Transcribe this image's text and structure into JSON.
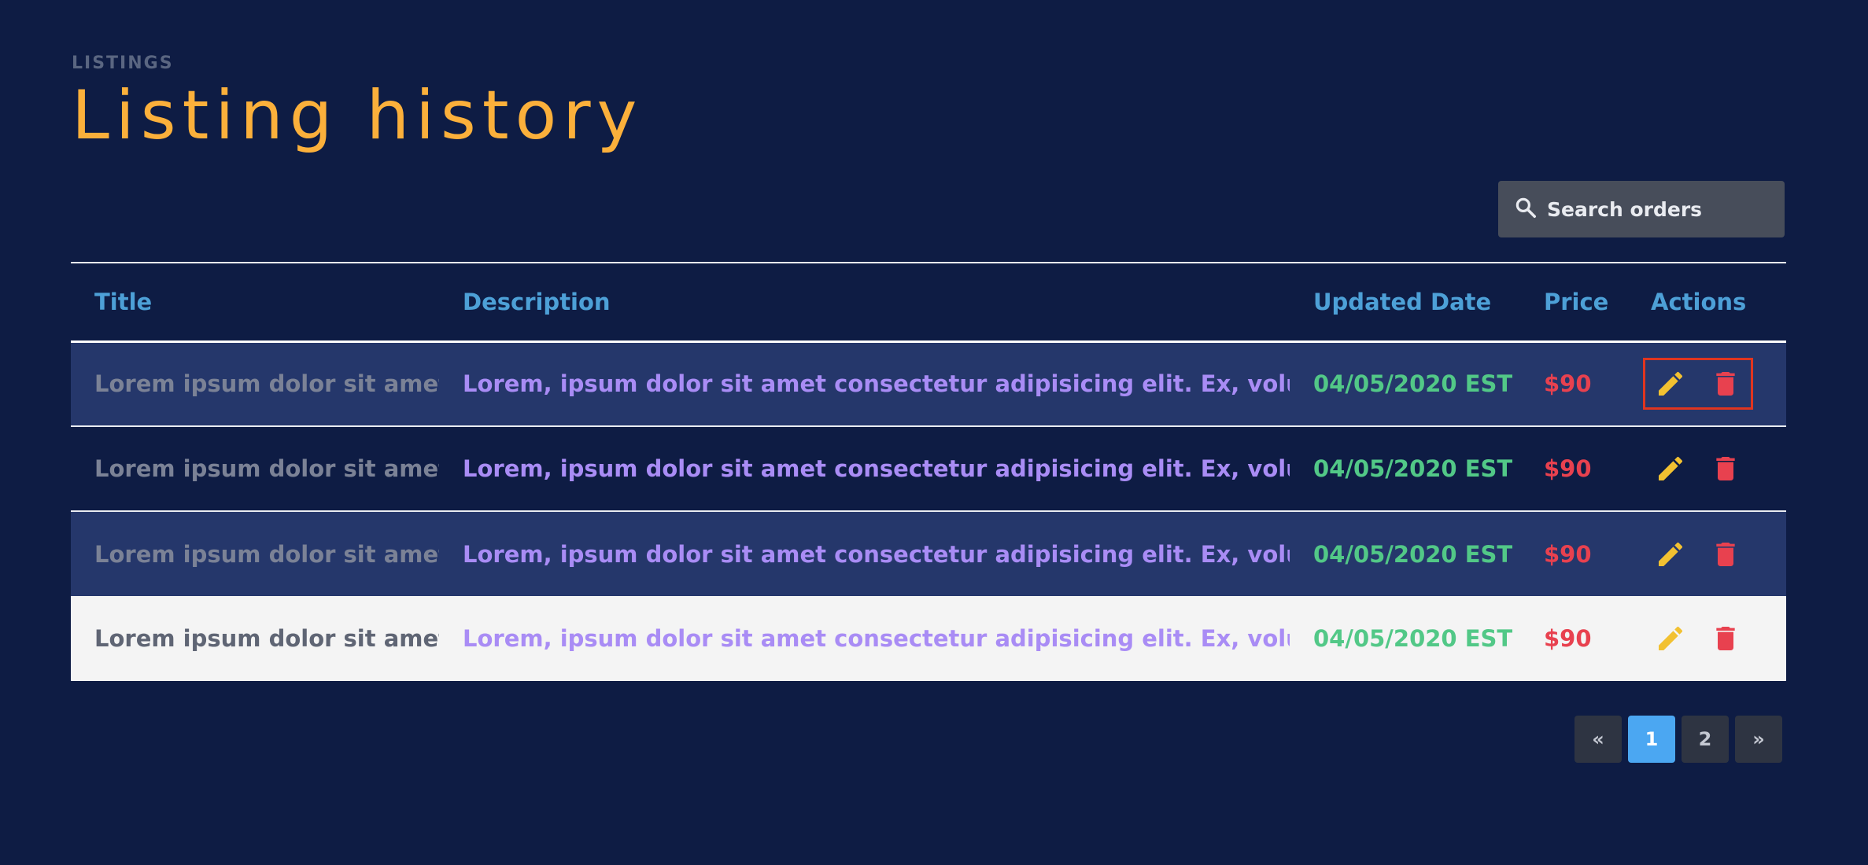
{
  "header": {
    "eyebrow": "LISTINGS",
    "title": "Listing history"
  },
  "search": {
    "placeholder": "Search orders",
    "icon": "search-icon"
  },
  "table": {
    "columns": [
      "Title",
      "Description",
      "Updated Date",
      "Price",
      "Actions"
    ],
    "rows": [
      {
        "title": "Lorem ipsum dolor sit amet.",
        "description": "Lorem, ipsum dolor sit amet consectetur adipisicing elit. Ex, voluptate!",
        "date": "04/05/2020 EST",
        "price": "$90",
        "focused": true
      },
      {
        "title": "Lorem ipsum dolor sit amet.",
        "description": "Lorem, ipsum dolor sit amet consectetur adipisicing elit. Ex, voluptate!",
        "date": "04/05/2020 EST",
        "price": "$90",
        "focused": false
      },
      {
        "title": "Lorem ipsum dolor sit amet.",
        "description": "Lorem, ipsum dolor sit amet consectetur adipisicing elit. Ex, voluptate!",
        "date": "04/05/2020 EST",
        "price": "$90",
        "focused": false
      },
      {
        "title": "Lorem ipsum dolor sit amet.",
        "description": "Lorem, ipsum dolor sit amet consectetur adipisicing elit. Ex, voluptate!",
        "date": "04/05/2020 EST",
        "price": "$90",
        "focused": false
      }
    ],
    "row_actions": {
      "edit_icon": "pencil-icon",
      "delete_icon": "trash-icon"
    }
  },
  "pagination": {
    "prev": "«",
    "pages": [
      "1",
      "2"
    ],
    "current": "1",
    "next": "»"
  },
  "colors": {
    "background": "#0e1c44",
    "title": "#fbb03b",
    "header_text": "#4da0d7",
    "description": "#a98cf5",
    "date": "#52c887",
    "price": "#e8414f",
    "edit_icon": "#f2c131",
    "delete_icon": "#e8414f",
    "focus_ring": "#e0351f",
    "active_page": "#4ba7f2"
  }
}
